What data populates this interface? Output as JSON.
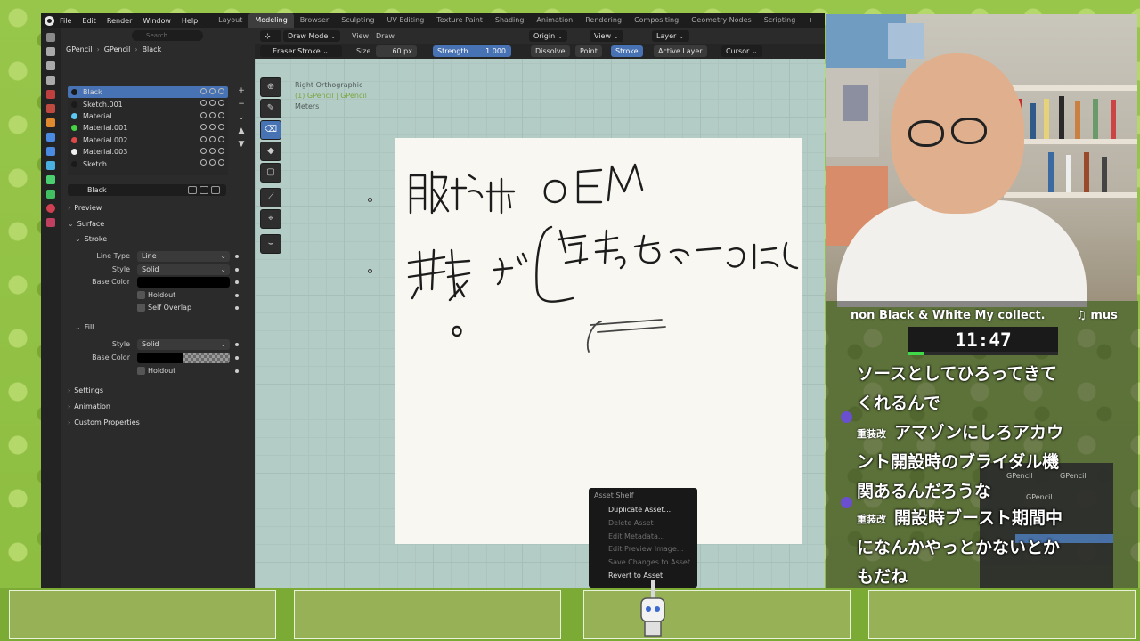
{
  "topbar": {
    "menus": [
      "File",
      "Edit",
      "Render",
      "Window",
      "Help"
    ],
    "workspaces": [
      "Layout",
      "Modeling",
      "Browser",
      "Sculpting",
      "UV Editing",
      "Texture Paint",
      "Shading",
      "Animation",
      "Rendering",
      "Compositing",
      "Geometry Nodes",
      "Scripting",
      "+"
    ],
    "active_workspace": "Modeling"
  },
  "properties": {
    "search_placeholder": "Search",
    "breadcrumb": [
      "GPencil",
      "GPencil",
      "Black"
    ],
    "material_slots": [
      {
        "name": "Black",
        "color": "#1a1a1a",
        "selected": true
      },
      {
        "name": "Sketch.001",
        "color": "#1a1a1a",
        "selected": false
      },
      {
        "name": "Material",
        "color": "#5ac8f0",
        "selected": false
      },
      {
        "name": "Material.001",
        "color": "#44d444",
        "selected": false
      },
      {
        "name": "Material.002",
        "color": "#e04848",
        "selected": false
      },
      {
        "name": "Material.003",
        "color": "#f0f0f0",
        "selected": false
      },
      {
        "name": "Sketch",
        "color": "#1a1a1a",
        "selected": false
      }
    ],
    "material_field": "Black",
    "sections": {
      "preview": "Preview",
      "surface": "Surface",
      "stroke": "Stroke",
      "fill": "Fill",
      "settings": "Settings",
      "animation": "Animation",
      "custom": "Custom Properties"
    },
    "stroke": {
      "line_type_label": "Line Type",
      "line_type": "Line",
      "style_label": "Style",
      "style": "Solid",
      "base_color_label": "Base Color",
      "holdout": "Holdout",
      "self_overlap": "Self Overlap"
    },
    "fill": {
      "style_label": "Style",
      "style": "Solid",
      "base_color_label": "Base Color",
      "holdout": "Holdout"
    }
  },
  "viewport": {
    "mode": "Draw Mode",
    "menus": [
      "View",
      "Draw"
    ],
    "origin": "Origin",
    "view": "View",
    "layer": "Layer",
    "tool": "Eraser Stroke",
    "size_label": "Size",
    "size_value": "60 px",
    "strength_label": "Strength",
    "strength_value": "1.000",
    "dissolve": "Dissolve",
    "point": "Point",
    "stroke": "Stroke",
    "active_layer": "Active Layer",
    "cursor": "Cursor",
    "info_view": "Right Orthographic",
    "info_object": "(1) GPencil | GPencil",
    "info_units": "Meters"
  },
  "context_menu": {
    "title": "Asset Shelf",
    "items": [
      {
        "label": "Duplicate Asset...",
        "enabled": true
      },
      {
        "label": "Delete Asset",
        "enabled": false
      },
      {
        "label": "Edit Metadata...",
        "enabled": false
      },
      {
        "label": "Edit Preview Image...",
        "enabled": false
      },
      {
        "label": "Save Changes to Asset",
        "enabled": false
      },
      {
        "label": "Revert to Asset",
        "enabled": true
      }
    ]
  },
  "stream": {
    "music": "non Black & White My collect.",
    "music_note": "♫ mus",
    "timer": "11:47",
    "timer_progress": 0.1,
    "chat": [
      {
        "user": "",
        "text": "ソースとしてひろってきて"
      },
      {
        "user": "",
        "text": "くれるんで"
      },
      {
        "user": "重装改",
        "text": "アマゾンにしろアカウ"
      },
      {
        "user": "",
        "text": "ント開設時のブライダル機"
      },
      {
        "user": "",
        "text": "関あるんだろうな"
      },
      {
        "user": "重装改",
        "text": "開設時ブースト期間中"
      },
      {
        "user": "",
        "text": "になんかやっとかないとか"
      },
      {
        "user": "",
        "text": "もだね"
      }
    ],
    "mini_blender": [
      "GPencil",
      "GPencil",
      "GPencil"
    ]
  },
  "colors": {
    "accent": "#4772b3",
    "blender_bg": "#303030",
    "paper": "#f8f7f1"
  }
}
